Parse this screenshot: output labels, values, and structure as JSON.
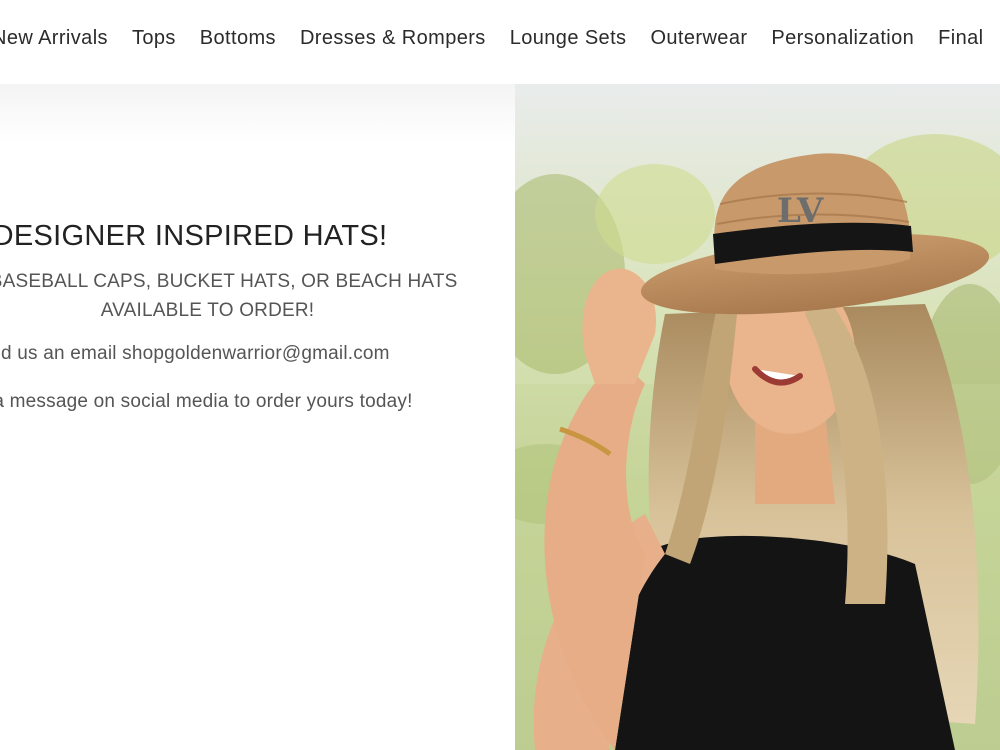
{
  "nav": {
    "items": [
      "New Arrivals",
      "Tops",
      "Bottoms",
      "Dresses & Rompers",
      "Lounge Sets",
      "Outerwear",
      "Personalization",
      "Final"
    ]
  },
  "promo": {
    "title": "DESIGNER INSPIRED HATS!",
    "subtitle": "ED BASEBALL CAPS, BUCKET HATS, OR BEACH HATS AVAILABLE TO ORDER!",
    "email_line": "nd us an email shopgoldenwarrior@gmail.com",
    "social_line": "us a message on social media to order yours today!"
  },
  "colors": {
    "background": "#ffffff",
    "text": "#2b2b2b"
  }
}
